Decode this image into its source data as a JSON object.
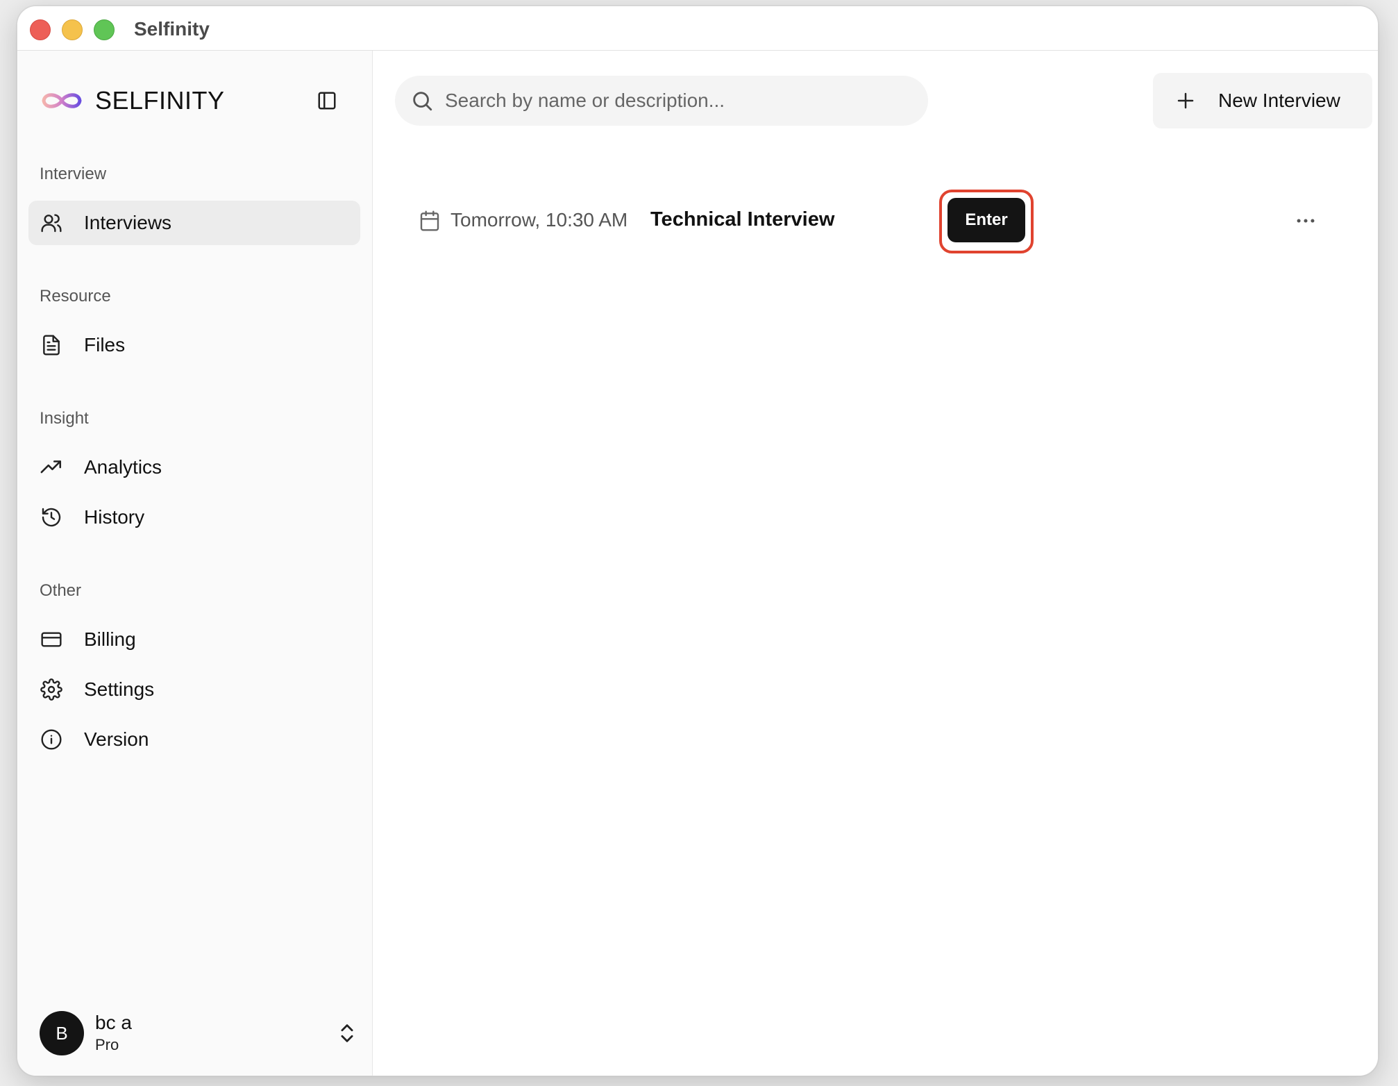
{
  "window": {
    "title": "Selfinity"
  },
  "sidebar": {
    "brand": "SELFINITY",
    "sections": [
      {
        "label": "Interview",
        "items": [
          {
            "label": "Interviews",
            "icon": "users-icon",
            "active": true
          }
        ]
      },
      {
        "label": "Resource",
        "items": [
          {
            "label": "Files",
            "icon": "file-text-icon"
          }
        ]
      },
      {
        "label": "Insight",
        "items": [
          {
            "label": "Analytics",
            "icon": "trending-up-icon"
          },
          {
            "label": "History",
            "icon": "history-icon"
          }
        ]
      },
      {
        "label": "Other",
        "items": [
          {
            "label": "Billing",
            "icon": "credit-card-icon"
          },
          {
            "label": "Settings",
            "icon": "gear-icon"
          },
          {
            "label": "Version",
            "icon": "info-icon"
          }
        ]
      }
    ],
    "user": {
      "initial": "B",
      "name": "bc a",
      "plan": "Pro"
    }
  },
  "main": {
    "search": {
      "placeholder": "Search by name or description..."
    },
    "new_button_label": "New Interview",
    "interviews": [
      {
        "date": "Tomorrow, 10:30 AM",
        "title": "Technical Interview",
        "action_label": "Enter"
      }
    ]
  },
  "colors": {
    "accent_dark": "#141414",
    "highlight_outline": "#e0432f",
    "logo_gradient": [
      "#f2a7a2",
      "#c36bd6",
      "#6a4ee0"
    ]
  }
}
